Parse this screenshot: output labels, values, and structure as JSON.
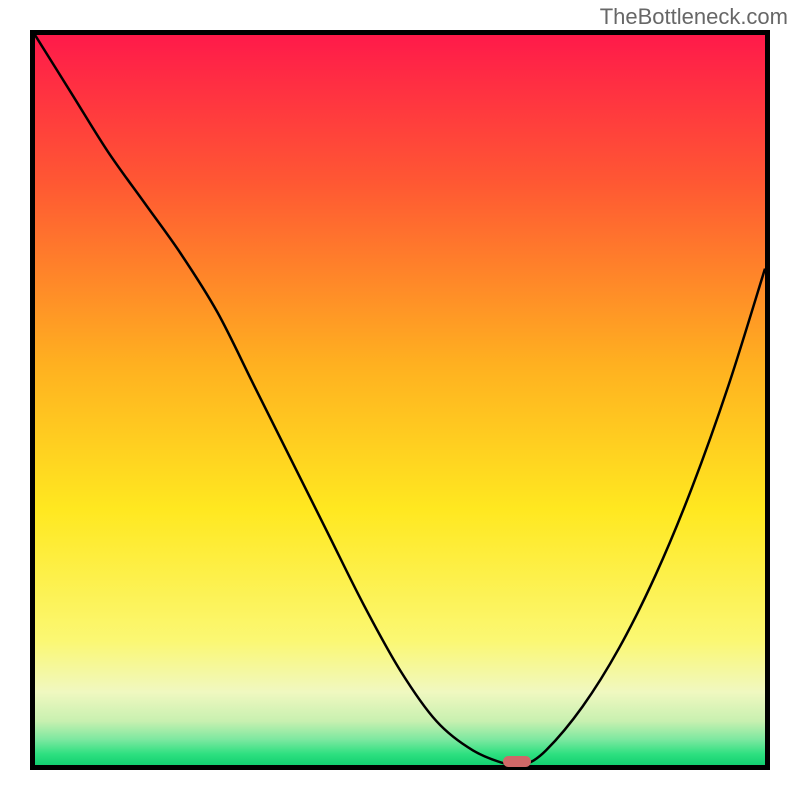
{
  "watermark": "TheBottleneck.com",
  "chart_data": {
    "type": "line",
    "title": "",
    "xlabel": "",
    "ylabel": "",
    "x": [
      0,
      5,
      10,
      15,
      20,
      25,
      30,
      35,
      40,
      45,
      50,
      55,
      60,
      65,
      67,
      70,
      75,
      80,
      85,
      90,
      95,
      100
    ],
    "values": [
      100,
      92,
      84,
      77,
      70,
      62,
      52,
      42,
      32,
      22,
      13,
      6,
      2,
      0,
      0,
      2,
      8,
      16,
      26,
      38,
      52,
      68
    ],
    "xlim": [
      0,
      100
    ],
    "ylim": [
      0,
      100
    ],
    "marker_x": 66,
    "marker_y": 0,
    "gradient": {
      "stops": [
        {
          "pos": 0.0,
          "color": "#ff1a4a"
        },
        {
          "pos": 0.2,
          "color": "#ff5733"
        },
        {
          "pos": 0.45,
          "color": "#ffb020"
        },
        {
          "pos": 0.65,
          "color": "#ffe820"
        },
        {
          "pos": 0.83,
          "color": "#fbf873"
        },
        {
          "pos": 0.9,
          "color": "#f0f8c0"
        },
        {
          "pos": 0.94,
          "color": "#c8f0b0"
        },
        {
          "pos": 0.965,
          "color": "#7de8a0"
        },
        {
          "pos": 0.985,
          "color": "#2ee080"
        },
        {
          "pos": 1.0,
          "color": "#12d070"
        }
      ]
    }
  }
}
